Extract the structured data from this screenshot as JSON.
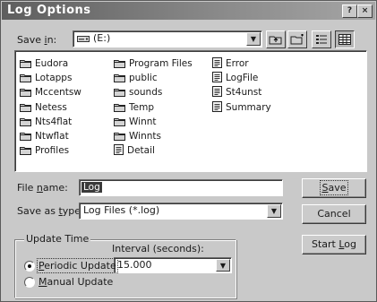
{
  "window": {
    "title": "Log Options",
    "help_button": "?",
    "close_button": "×"
  },
  "save_in": {
    "label_prefix": "Save ",
    "label_accel": "i",
    "label_suffix": "n:",
    "value": "(E:)"
  },
  "toolbar": {
    "up_folder": "up-folder-icon",
    "new_folder": "new-folder-icon",
    "list_view": "list-view-icon",
    "details_view": "details-view-icon"
  },
  "files": {
    "column1": [
      {
        "name": "Eudora",
        "type": "folder"
      },
      {
        "name": "Lotapps",
        "type": "folder"
      },
      {
        "name": "Mccentsw",
        "type": "folder"
      },
      {
        "name": "Netess",
        "type": "folder"
      },
      {
        "name": "Nts4flat",
        "type": "folder"
      },
      {
        "name": "Ntwflat",
        "type": "folder"
      },
      {
        "name": "Profiles",
        "type": "folder"
      }
    ],
    "column2": [
      {
        "name": "Program Files",
        "type": "folder"
      },
      {
        "name": "public",
        "type": "folder"
      },
      {
        "name": "sounds",
        "type": "folder"
      },
      {
        "name": "Temp",
        "type": "folder"
      },
      {
        "name": "Winnt",
        "type": "folder"
      },
      {
        "name": "Winnts",
        "type": "folder"
      },
      {
        "name": "Detail",
        "type": "file"
      }
    ],
    "column3": [
      {
        "name": "Error",
        "type": "file"
      },
      {
        "name": "LogFile",
        "type": "file"
      },
      {
        "name": "St4unst",
        "type": "file"
      },
      {
        "name": "Summary",
        "type": "file"
      }
    ]
  },
  "file_name": {
    "label_prefix": "File ",
    "label_accel": "n",
    "label_suffix": "ame:",
    "value": "Log"
  },
  "save_as_type": {
    "label_prefix": "Save as ",
    "label_accel": "t",
    "label_suffix": "ype:",
    "value": "Log Files (*.log)"
  },
  "buttons": {
    "save": "Save",
    "save_accel": "S",
    "save_rest": "ave",
    "cancel": "Cancel",
    "start_log_prefix": "Start ",
    "start_log_accel": "L",
    "start_log_rest": "og"
  },
  "update_time": {
    "group_title": "Update Time",
    "interval_label": "Interval (seconds):",
    "interval_value": "15.000",
    "periodic_accel": "P",
    "periodic_rest": "eriodic Update",
    "periodic_selected": true,
    "manual_accel": "M",
    "manual_rest": "anual Update",
    "manual_selected": false
  }
}
